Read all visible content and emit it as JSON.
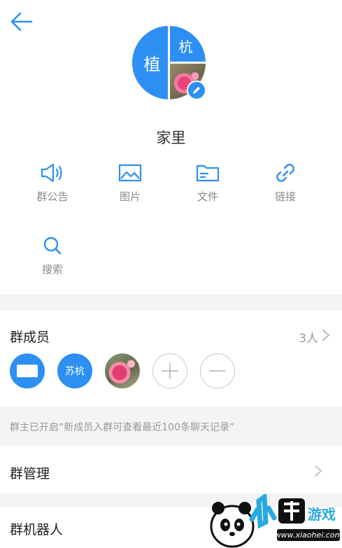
{
  "header": {
    "back_icon": "arrow-left-icon"
  },
  "group": {
    "avatar_left_char": "植",
    "avatar_top_right_char": "杭",
    "name": "家里"
  },
  "tools": [
    {
      "label": "群公告",
      "icon": "megaphone-icon"
    },
    {
      "label": "图片",
      "icon": "image-icon"
    },
    {
      "label": "文件",
      "icon": "folder-icon"
    },
    {
      "label": "链接",
      "icon": "link-icon"
    },
    {
      "label": "搜索",
      "icon": "search-icon"
    }
  ],
  "members": {
    "title": "群成员",
    "count": "3人",
    "avatars": [
      "",
      "苏杭",
      ""
    ],
    "add_icon": "plus-icon",
    "remove_icon": "minus-icon"
  },
  "notice": "群主已开启“新成员入群可查看最近100条聊天记录”",
  "manage": {
    "title": "群管理"
  },
  "robot": {
    "title": "群机器人"
  },
  "watermark": {
    "brand": "小黑游戏",
    "url": "www.xiaohei.com"
  },
  "colors": {
    "accent": "#2d8ff2",
    "band": "#f4f4f6",
    "muted": "#999999"
  }
}
